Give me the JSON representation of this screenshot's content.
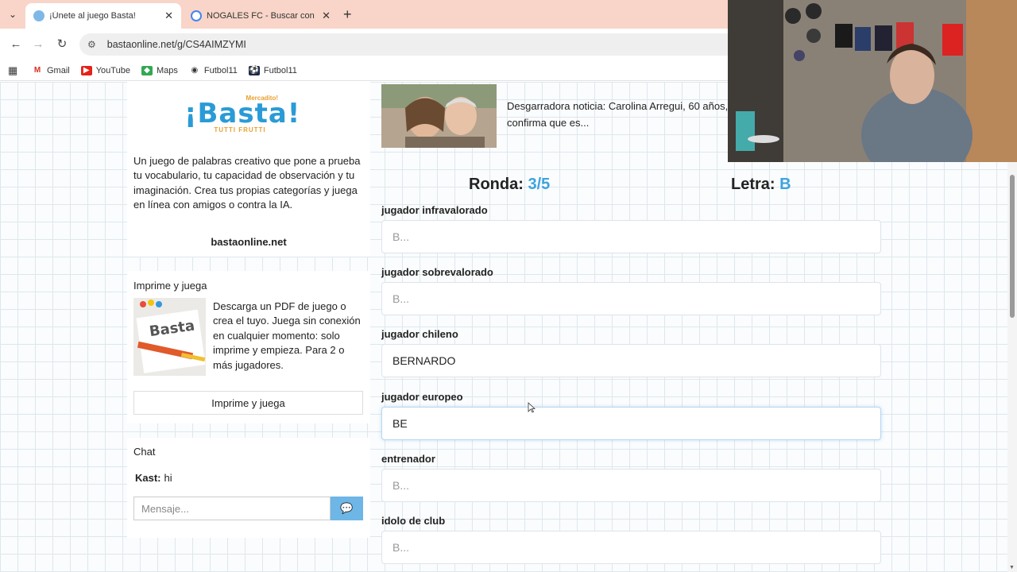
{
  "browser": {
    "tabs": [
      {
        "title": "¡Únete al juego Basta!",
        "active": true
      },
      {
        "title": "NOGALES FC - Buscar con Goog",
        "active": false
      }
    ],
    "url": "bastaonline.net/g/CS4AIMZYMI",
    "bookmarks": [
      "Gmail",
      "YouTube",
      "Maps",
      "Futbol11",
      "Futbol11"
    ]
  },
  "sidebar": {
    "logo": {
      "top": "Mercadito!",
      "main": "¡Basta!",
      "sub": "TUTTI FRUTTI"
    },
    "description": "Un juego de palabras creativo que pone a prueba tu vocabulario, tu capacidad de observación y tu imaginación. Crea tus propias categorías y juega en línea con amigos o contra la IA.",
    "site": "bastaonline.net",
    "print": {
      "title": "Imprime y juega",
      "text": "Descarga un PDF de juego o crea el tuyo. Juega sin conexión en cualquier momento: solo imprime y empieza. Para 2 o más jugadores.",
      "button": "Imprime y juega"
    },
    "chat": {
      "title": "Chat",
      "messages": [
        {
          "user": "Kast:",
          "text": "hi"
        }
      ],
      "placeholder": "Mensaje..."
    }
  },
  "news": {
    "text": "Desgarradora noticia: Carolina Arregui, 60 años, confirma que es..."
  },
  "game": {
    "round_label": "Ronda:",
    "round_value": "3/5",
    "letter_label": "Letra:",
    "letter_value": "B",
    "fields": [
      {
        "label": "jugador infravalorado",
        "value": "",
        "placeholder": "B..."
      },
      {
        "label": "jugador sobrevalorado",
        "value": "",
        "placeholder": "B..."
      },
      {
        "label": "jugador chileno",
        "value": "BERNARDO",
        "placeholder": "B..."
      },
      {
        "label": "jugador europeo",
        "value": "BE",
        "placeholder": "B..."
      },
      {
        "label": "entrenador",
        "value": "",
        "placeholder": "B..."
      },
      {
        "label": "idolo de club",
        "value": "",
        "placeholder": "B..."
      }
    ]
  },
  "colors": {
    "accent": "#3ea3de",
    "tabbar": "#f8d5c8",
    "send_button": "#6db6e6"
  }
}
